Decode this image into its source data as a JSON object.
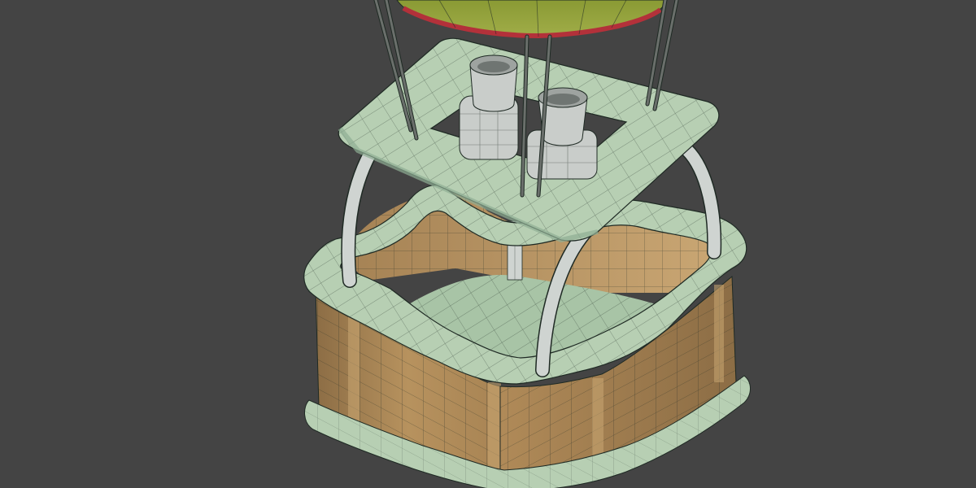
{
  "scene": {
    "background": "#444444",
    "colors": {
      "trim": "#b7cfb3",
      "trim_dark": "#8fae94",
      "wicker": "#b7925e",
      "wicker_dark": "#8c6d45",
      "wicker_light": "#caa873",
      "pipe": "#cfd4d1",
      "burner": "#c9cdca",
      "balloon_green": "#8a9a34",
      "balloon_red": "#b3313a",
      "wire": "#1f2a24",
      "rope": "#6a6f6b"
    }
  }
}
